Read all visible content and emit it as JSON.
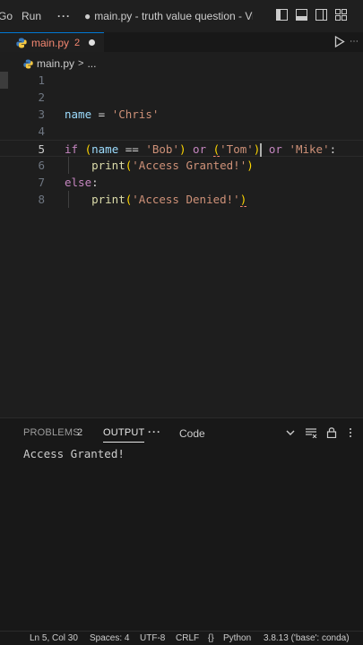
{
  "titlebar": {
    "menu": [
      "Go",
      "Run"
    ],
    "more": "···",
    "window_title": "main.py - truth value question - Visu…"
  },
  "tab": {
    "name": "main.py",
    "problems": "2"
  },
  "breadcrumb": {
    "file": "main.py",
    "separator": ">",
    "more": "..."
  },
  "editor": {
    "line_numbers": [
      "1",
      "2",
      "3",
      "4",
      "5",
      "6",
      "7",
      "8"
    ],
    "line3": {
      "name": "name",
      "eq": " = ",
      "value": "'Chris'"
    },
    "line5": {
      "if": "if",
      "sp1": " ",
      "paren_open": "(",
      "name": "name",
      "eqeq": " == ",
      "bob": "'Bob'",
      "paren_close": ")",
      "or1": " or ",
      "paren2_open": "(",
      "tom": "'Tom'",
      "paren2_close": ")",
      "or2": " or ",
      "mike": "'Mike'",
      "colon": ":"
    },
    "line6": {
      "indent": "    ",
      "print": "print",
      "open": "(",
      "str": "'Access Granted!'",
      "close": ")"
    },
    "line7": {
      "else": "else",
      "colon": ":"
    },
    "line8": {
      "indent": "    ",
      "print": "print",
      "open": "(",
      "str": "'Access Denied!'",
      "close": ")"
    }
  },
  "panel": {
    "tabs": {
      "problems": "PROBLEMS",
      "problems_count": "2",
      "output": "OUTPUT"
    },
    "more": "···",
    "channel": "Code",
    "output_text": "Access Granted!"
  },
  "statusbar": {
    "position": "Ln 5, Col 30",
    "spaces": "Spaces: 4",
    "encoding": "UTF-8",
    "eol": "CRLF",
    "language": "Python",
    "interpreter": "3.8.13 ('base': conda)"
  },
  "colors": {
    "background": "#1e1e1e",
    "keyword": "#c586c0",
    "variable": "#9cdcfe",
    "string": "#ce9178",
    "function": "#dcdcaa",
    "error": "#f48771"
  }
}
